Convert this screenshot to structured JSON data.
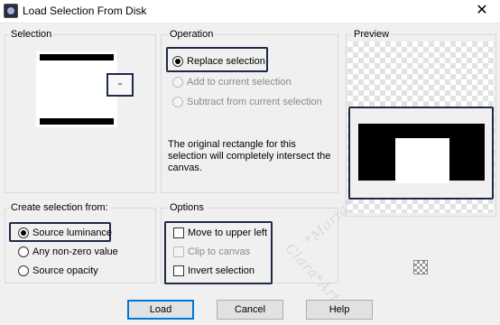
{
  "window": {
    "title": "Load Selection From Disk",
    "close_glyph": "✕"
  },
  "selection_group": {
    "label": "Selection"
  },
  "operation_group": {
    "label": "Operation",
    "options": [
      {
        "label": "Replace selection",
        "selected": true,
        "enabled": true
      },
      {
        "label": "Add to current selection",
        "selected": false,
        "enabled": false
      },
      {
        "label": "Subtract from current selection",
        "selected": false,
        "enabled": false
      }
    ],
    "description": "The original rectangle for this selection will completely intersect the canvas."
  },
  "preview_group": {
    "label": "Preview"
  },
  "create_group": {
    "label": "Create selection from:",
    "options": [
      {
        "label": "Source luminance",
        "selected": true
      },
      {
        "label": "Any non-zero value",
        "selected": false
      },
      {
        "label": "Source opacity",
        "selected": false
      }
    ]
  },
  "options_group": {
    "label": "Options",
    "options": [
      {
        "label": "Move to upper left",
        "checked": false,
        "enabled": true
      },
      {
        "label": "Clip to canvas",
        "checked": false,
        "enabled": false
      },
      {
        "label": "Invert selection",
        "checked": false,
        "enabled": true
      }
    ]
  },
  "watermark": {
    "line1": "*Maria*",
    "line2": "Clara*Arts"
  },
  "buttons": {
    "load": "Load",
    "cancel": "Cancel",
    "help": "Help"
  },
  "colors": {
    "highlight": "#1e2a4a",
    "default_button_border": "#0078d7"
  }
}
